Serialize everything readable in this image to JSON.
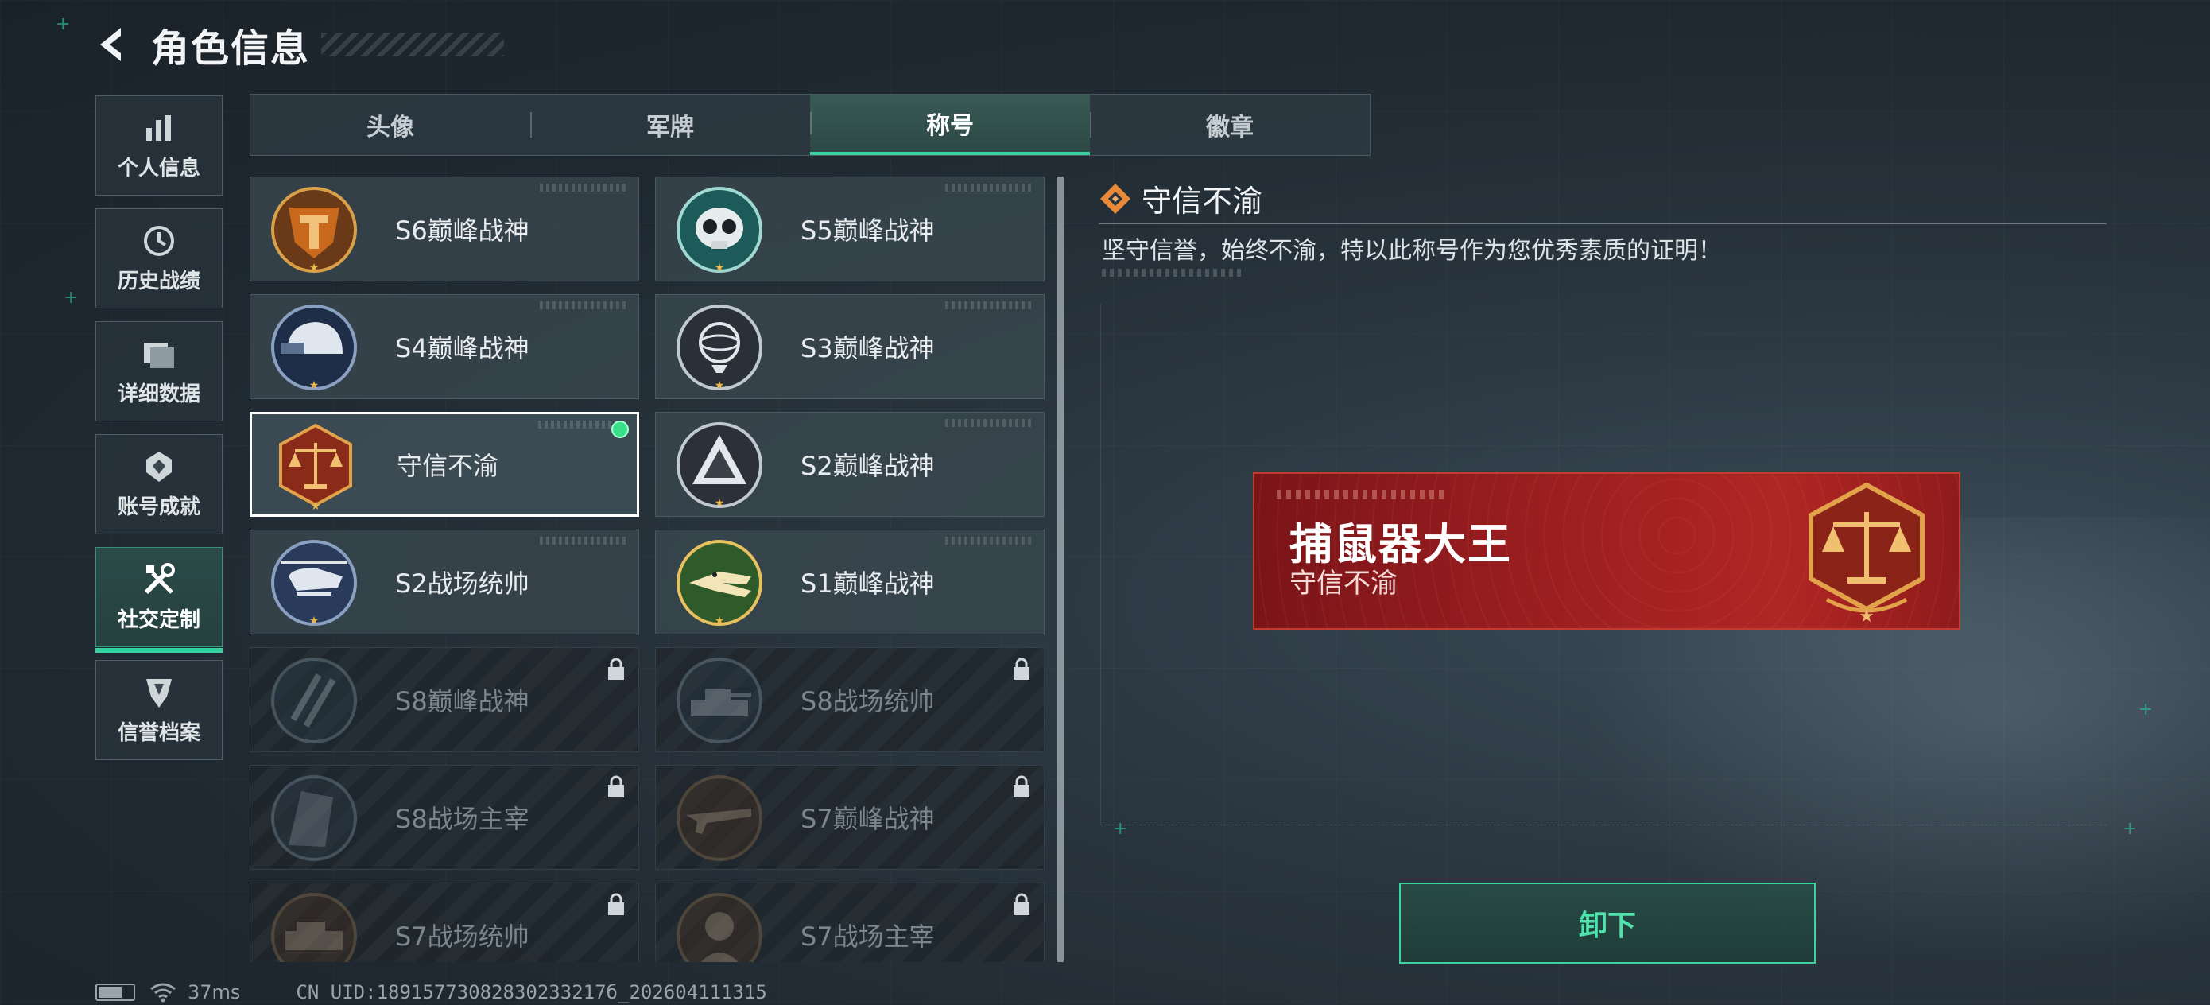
{
  "header": {
    "title": "角色信息"
  },
  "sidebar": {
    "items": [
      {
        "label": "个人信息",
        "icon": "bar-chart-icon"
      },
      {
        "label": "历史战绩",
        "icon": "history-icon"
      },
      {
        "label": "详细数据",
        "icon": "folder-icon"
      },
      {
        "label": "账号成就",
        "icon": "achievement-icon"
      },
      {
        "label": "社交定制",
        "icon": "tools-icon",
        "active": true
      },
      {
        "label": "信誉档案",
        "icon": "reputation-icon"
      }
    ]
  },
  "tabs": [
    {
      "label": "头像"
    },
    {
      "label": "军牌"
    },
    {
      "label": "称号",
      "active": true
    },
    {
      "label": "徽章"
    }
  ],
  "titles": [
    {
      "name": "S6巅峰战神",
      "emblem": "orange-shield-emblem",
      "locked": false
    },
    {
      "name": "S5巅峰战神",
      "emblem": "skull-emblem",
      "locked": false
    },
    {
      "name": "S4巅峰战神",
      "emblem": "helmet-emblem",
      "locked": false
    },
    {
      "name": "S3巅峰战神",
      "emblem": "globe-emblem",
      "locked": false
    },
    {
      "name": "守信不渝",
      "emblem": "scales-emblem",
      "locked": false,
      "selected": true,
      "equipped": true
    },
    {
      "name": "S2巅峰战神",
      "emblem": "triangle-emblem",
      "locked": false
    },
    {
      "name": "S2战场统帅",
      "emblem": "helicopter-emblem",
      "locked": false
    },
    {
      "name": "S1巅峰战神",
      "emblem": "crocodile-emblem",
      "locked": false
    },
    {
      "name": "S8巅峰战神",
      "emblem": "slash-emblem",
      "locked": true
    },
    {
      "name": "S8战场统帅",
      "emblem": "tank-emblem",
      "locked": true
    },
    {
      "name": "S8战场主宰",
      "emblem": "building-emblem",
      "locked": true
    },
    {
      "name": "S7巅峰战神",
      "emblem": "rifle-emblem",
      "locked": true
    },
    {
      "name": "S7战场统帅",
      "emblem": "vehicle-emblem",
      "locked": true
    },
    {
      "name": "S7战场主宰",
      "emblem": "soldier-emblem",
      "locked": true
    }
  ],
  "detail": {
    "title": "守信不渝",
    "description": "坚守信誉，始终不渝，特以此称号作为您优秀素质的证明！",
    "nameplate": {
      "player_name": "捕鼠器大王",
      "title": "守信不渝"
    },
    "action_label": "卸下"
  },
  "status": {
    "latency": "37ms",
    "uid": "CN UID:18915773082830233217б_202604111315"
  },
  "colors": {
    "accent": "#3bd39e",
    "nameplate": "#9a1e20",
    "equipped": "#38e08a"
  }
}
